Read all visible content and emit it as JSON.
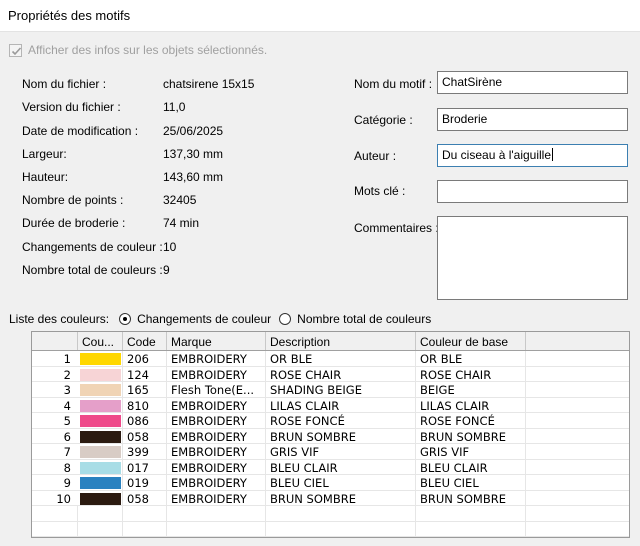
{
  "window": {
    "title": "Propriétés des motifs"
  },
  "show_info": {
    "label": "Afficher des infos sur les objets sélectionnés.",
    "checked": true
  },
  "info": [
    {
      "label": "Nom du fichier :",
      "value": "chatsirene 15x15"
    },
    {
      "label": "Version du fichier :",
      "value": "11,0"
    },
    {
      "label": "Date de modification :",
      "value": "25/06/2025"
    },
    {
      "label": "Largeur:",
      "value": "137,30 mm"
    },
    {
      "label": "Hauteur:",
      "value": "143,60 mm"
    },
    {
      "label": "Nombre de points :",
      "value": "32405"
    },
    {
      "label": "Durée de broderie :",
      "value": "74 min"
    },
    {
      "label": "Changements de couleur :",
      "value": "10"
    },
    {
      "label": "Nombre total de couleurs :",
      "value": "9"
    }
  ],
  "fields": {
    "name": {
      "label": "Nom du motif :",
      "value": "ChatSirène"
    },
    "category": {
      "label": "Catégorie :",
      "value": "Broderie"
    },
    "author": {
      "label": "Auteur :",
      "value": "Du ciseau à l'aiguille"
    },
    "keywords": {
      "label": "Mots clé :",
      "value": ""
    },
    "comments": {
      "label": "Commentaires :",
      "value": ""
    }
  },
  "color_list": {
    "label": "Liste des couleurs:",
    "option_changes": "Changements de couleur",
    "option_total": "Nombre total de couleurs",
    "selected": "changes"
  },
  "table": {
    "headers": [
      "Cou...",
      "Code",
      "Marque",
      "Description",
      "Couleur de base"
    ],
    "rows": [
      {
        "n": "1",
        "color": "#ffd700",
        "code": "206",
        "brand": "EMBROIDERY",
        "desc": "OR BLE",
        "base": "OR BLE"
      },
      {
        "n": "2",
        "color": "#f7d4d6",
        "code": "124",
        "brand": "EMBROIDERY",
        "desc": "ROSE CHAIR",
        "base": "ROSE CHAIR"
      },
      {
        "n": "3",
        "color": "#f0d4b5",
        "code": "165",
        "brand": "Flesh Tone(E...",
        "desc": "SHADING BEIGE",
        "base": "BEIGE"
      },
      {
        "n": "4",
        "color": "#e59fc9",
        "code": "810",
        "brand": "EMBROIDERY",
        "desc": "LILAS CLAIR",
        "base": "LILAS CLAIR"
      },
      {
        "n": "5",
        "color": "#ef4a8a",
        "code": "086",
        "brand": "EMBROIDERY",
        "desc": "ROSE FONCÉ",
        "base": "ROSE FONCÉ"
      },
      {
        "n": "6",
        "color": "#2b1a10",
        "code": "058",
        "brand": "EMBROIDERY",
        "desc": "BRUN SOMBRE",
        "base": "BRUN SOMBRE"
      },
      {
        "n": "7",
        "color": "#d8ccc5",
        "code": "399",
        "brand": "EMBROIDERY",
        "desc": "GRIS VIF",
        "base": "GRIS VIF"
      },
      {
        "n": "8",
        "color": "#a8dde6",
        "code": "017",
        "brand": "EMBROIDERY",
        "desc": "BLEU CLAIR",
        "base": "BLEU CLAIR"
      },
      {
        "n": "9",
        "color": "#2a82c0",
        "code": "019",
        "brand": "EMBROIDERY",
        "desc": "BLEU CIEL",
        "base": "BLEU CIEL"
      },
      {
        "n": "10",
        "color": "#2b1a10",
        "code": "058",
        "brand": "EMBROIDERY",
        "desc": "BRUN SOMBRE",
        "base": "BRUN SOMBRE"
      }
    ]
  }
}
